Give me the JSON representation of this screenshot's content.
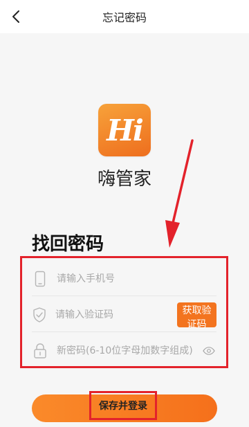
{
  "header": {
    "title": "忘记密码",
    "back_icon": "chevron-left-icon"
  },
  "app": {
    "logo_text": "Hi",
    "name": "嗨管家"
  },
  "form": {
    "title": "找回密码",
    "phone_placeholder": "请输入手机号",
    "code_placeholder": "请输入验证码",
    "get_code_label": "获取验证码",
    "password_placeholder": "新密码(6-10位字母加数字组成)"
  },
  "actions": {
    "save_label": "保存并登录"
  },
  "colors": {
    "accent": "#f3741f",
    "annotation_red": "#e3222b"
  }
}
